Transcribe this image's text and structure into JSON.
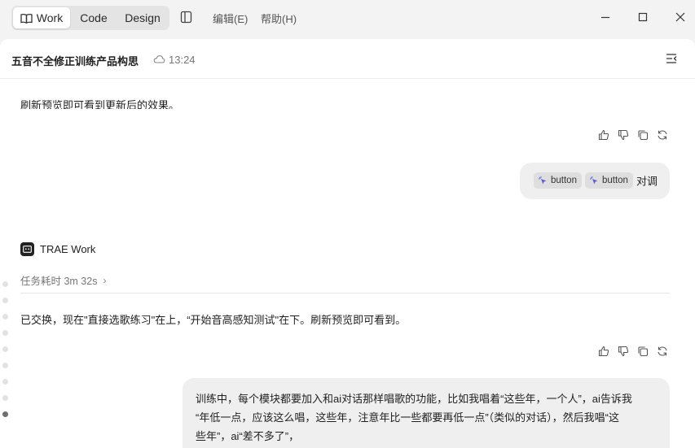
{
  "titlebar": {
    "modes": [
      "Work",
      "Code",
      "Design"
    ],
    "active_mode": "Work",
    "menu": [
      "编辑(E)",
      "帮助(H)"
    ]
  },
  "header": {
    "title": "五音不全修正训练产品构思",
    "time": "13:24"
  },
  "messages": {
    "clipped_text": "刷新预览即可看到更新后的效果。",
    "user_chips": [
      "button",
      "button"
    ],
    "user_suffix": "对调",
    "agent_name": "TRAE Work",
    "duration": "任务耗时 3m 32s",
    "agent_reply": "已交换，现在\"直接选歌练习\"在上，“开始音高感知测试\"在下。刷新预览即可看到。",
    "user_long_lines": [
      "训练中，每个模块都要加入和ai对话那样唱歌的功能，比如我唱着“这些年，一个人”，ai告诉我",
      "“年低一点，应该这么唱，这些年，注意年比一些都要再低一点”（类似的对话），然后我唱“这",
      "些年”，ai“差不多了”，"
    ]
  },
  "icons": {
    "action_icons": [
      "thumbs-up-icon",
      "thumbs-down-icon",
      "copy-icon",
      "refresh-icon"
    ]
  }
}
